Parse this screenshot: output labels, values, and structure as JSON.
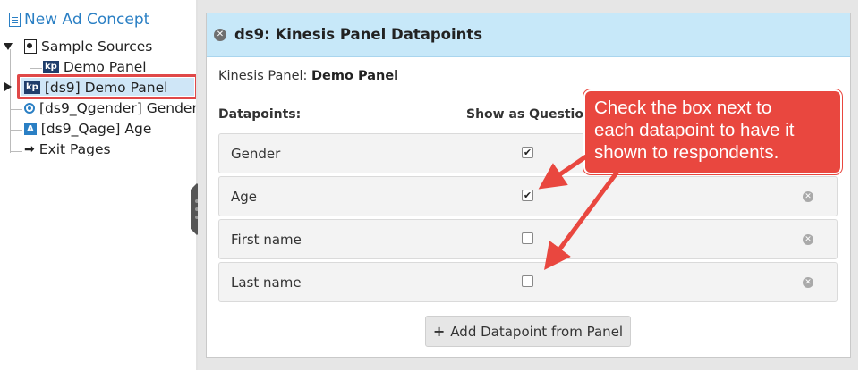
{
  "tree": {
    "root": "New Ad Concept",
    "nodes": [
      {
        "label": "Sample Sources"
      },
      {
        "label": "Demo Panel"
      },
      {
        "label": "[ds9] Demo Panel"
      },
      {
        "label": "[ds9_Qgender] Gender"
      },
      {
        "label": "[ds9_Qage] Age"
      },
      {
        "label": "Exit Pages"
      }
    ],
    "badges": {
      "kp": "kp",
      "alpha": "A"
    }
  },
  "panel": {
    "title": "ds9: Kinesis Panel Datapoints",
    "kp_label": "Kinesis Panel:",
    "kp_value": "Demo Panel",
    "datapoints_header": "Datapoints:",
    "show_header": "Show as Question",
    "rows": [
      {
        "label": "Gender",
        "checked": true
      },
      {
        "label": "Age",
        "checked": true
      },
      {
        "label": "First name",
        "checked": false
      },
      {
        "label": "Last name",
        "checked": false
      }
    ],
    "add_button": "Add Datapoint from Panel"
  },
  "callout": {
    "line1": "Check the box next to",
    "line2": "each datapoint to have it",
    "line3": "shown to respondents."
  },
  "colors": {
    "accent": "#2a7fc4",
    "header": "#c7e8f9",
    "callout": "#e9473f",
    "highlight": "#e04848"
  }
}
